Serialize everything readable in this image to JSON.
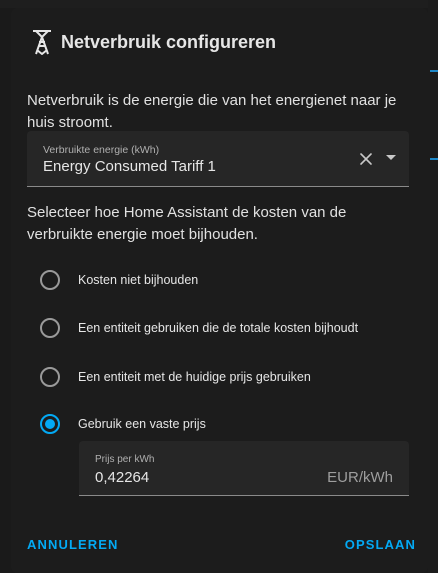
{
  "dialog": {
    "title": "Netverbruik configureren",
    "description": "Netverbruik is de energie die van het energienet naar je huis stroomt.",
    "energy_field": {
      "label": "Verbruikte energie (kWh)",
      "value": "Energy Consumed Tariff 1"
    },
    "cost_description": "Selecteer hoe Home Assistant de kosten van de verbruikte energie moet bijhouden.",
    "options": [
      {
        "label": "Kosten niet bijhouden",
        "selected": false
      },
      {
        "label": "Een entiteit gebruiken die de totale kosten bijhoudt",
        "selected": false
      },
      {
        "label": "Een entiteit met de huidige prijs gebruiken",
        "selected": false
      },
      {
        "label": "Gebruik een vaste prijs",
        "selected": true
      }
    ],
    "price_field": {
      "label": "Prijs per kWh",
      "value": "0,42264",
      "suffix": "EUR/kWh"
    },
    "cancel_label": "ANNULEREN",
    "save_label": "OPSLAAN"
  },
  "icons": {
    "title_icon": "transmission-tower-icon",
    "clear": "close-icon",
    "dropdown": "menu-down-icon"
  },
  "colors": {
    "accent": "#03a9f4",
    "dialog_bg": "#1c1c1c",
    "field_bg": "#262626"
  }
}
